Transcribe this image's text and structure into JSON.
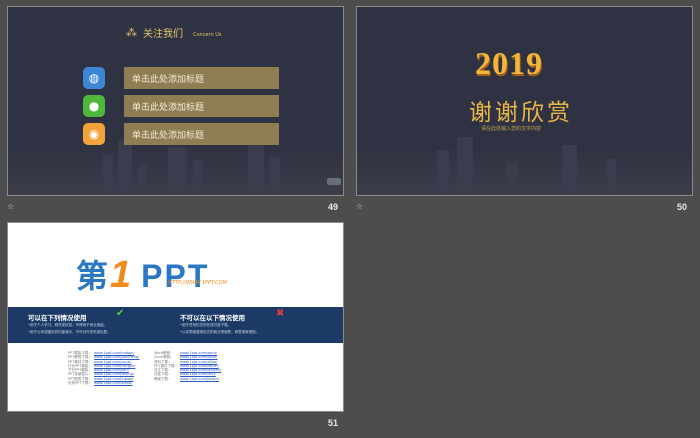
{
  "slides": [
    {
      "number": "49",
      "star": "☆",
      "title_cn": "关注我们",
      "title_en": "Concern Us",
      "rows": [
        {
          "label": "单击此处添加标题",
          "icon": "globe-icon"
        },
        {
          "label": "单击此处添加标题",
          "icon": "wechat-icon"
        },
        {
          "label": "单击此处添加标题",
          "icon": "weibo-icon"
        }
      ]
    },
    {
      "number": "50",
      "star": "☆",
      "year": "2019",
      "thanks": "谢谢欣赏",
      "subline": "请在此处输入您的文字内容"
    },
    {
      "number": "51",
      "logo_a": "第",
      "logo_b": "1",
      "logo_c": "PPT",
      "logo_url": "HTTP://WWW.1PPT.COM",
      "can_use_title": "可以在下列情况使用",
      "can_use_lines": [
        "•用于个人学习、研究或欣赏，不得用于商业用途。",
        "•用于公司或团队的内部演示，不可对外发布或出售。"
      ],
      "cannot_use_title": "不可以在以下情况使用",
      "cannot_use_lines": [
        "•用于任何形式的在线付费下载。",
        "•以实物或虚拟形式的商业再销售，转售或转授权。"
      ],
      "links_left_labels": "PPT模板下载：\nPPT教程下载：\nPPT素材下载：\n行业PPT模板：\n节日PPT模板：\nPPT背景图片：\nPPT图表下载：\n优秀PPT下载：",
      "links_left_urls": "www.1ppt.com/moban/\nwww.1ppt.com/jiaocheng/\nwww.1ppt.com/sucai/\nwww.1ppt.com/hangye/\nwww.1ppt.com/jieri/\nwww.1ppt.com/beijing/\nwww.1ppt.com/tubiao/\nwww.1ppt.com/xiazai/",
      "links_right_labels": "Word教程：\nExcel教程：\n资料下载：\nPPT课件下载：\n范文下载：\n试卷下载：\n教案下载：",
      "links_right_urls": "www.1ppt.com/word/\nwww.1ppt.com/excel/\nwww.1ppt.com/ziliao/\nwww.1ppt.com/kejian/\nwww.1ppt.com/fanwen/\nwww.1ppt.com/shiti/\nwww.1ppt.com/jiaoan/"
    }
  ]
}
